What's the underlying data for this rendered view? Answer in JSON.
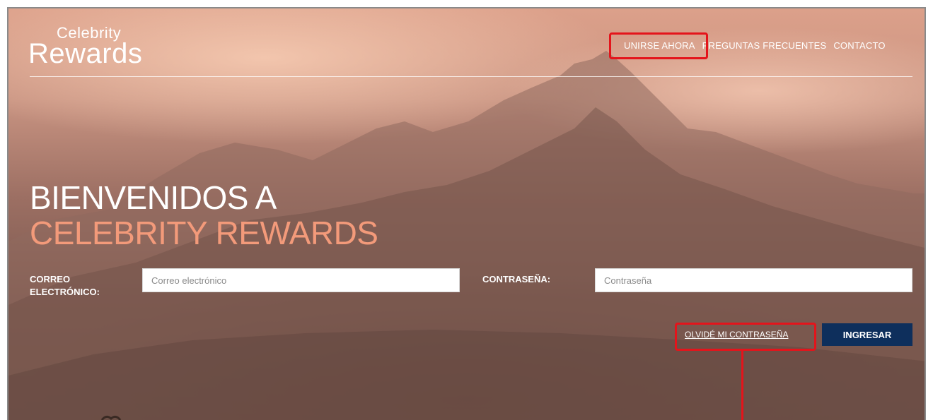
{
  "logo": {
    "line1": "Celebrity",
    "line2": "Rewards"
  },
  "nav": {
    "join": "UNIRSE AHORA",
    "faq": "PREGUNTAS FRECUENTES",
    "contact": "CONTACTO"
  },
  "hero": {
    "title_line1": "BIENVENIDOS A",
    "title_line2": "CELEBRITY REWARDS"
  },
  "login_form": {
    "email_label": "CORREO ELECTRÓNICO:",
    "email_placeholder": "Correo electrónico",
    "email_value": "",
    "password_label": "CONTRASEÑA:",
    "password_placeholder": "Contraseña",
    "password_value": "",
    "forgot_password": "OLVIDÉ MI CONTRASEÑA",
    "submit": "INGRESAR"
  },
  "colors": {
    "accent_salmon": "#f39a7a",
    "button_navy": "#0e2f5c",
    "highlight_red": "#e4141b"
  }
}
